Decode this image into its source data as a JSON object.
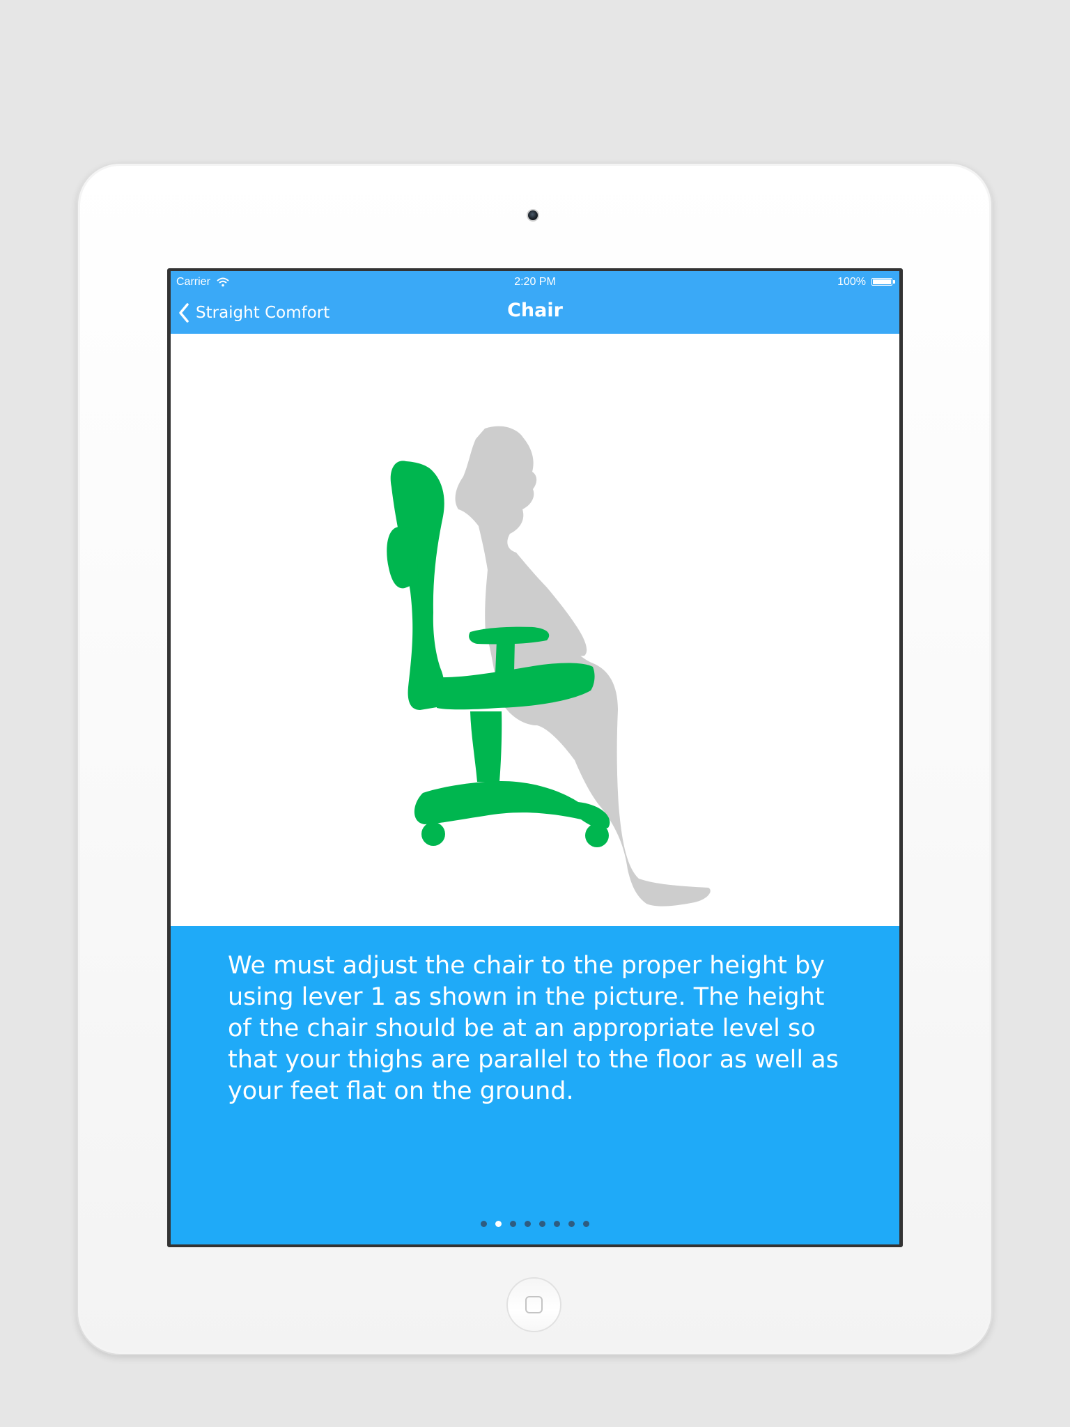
{
  "status_bar": {
    "carrier": "Carrier",
    "time": "2:20 PM",
    "battery": "100%"
  },
  "navbar": {
    "back_label": "Straight Comfort",
    "title": "Chair",
    "background_color": "#3aa9f7"
  },
  "illustration": {
    "chair_color": "#00b64f",
    "person_color": "#cdcdcd"
  },
  "content": {
    "description": "We must adjust the chair to the proper height by using lever 1 as shown in the picture. The height of the chair should be at an appropriate level so that your thighs are parallel to the floor as well as your feet flat on the ground.",
    "panel_color": "#1faaf8"
  },
  "pagination": {
    "total_pages": 8,
    "current_page": 2
  }
}
